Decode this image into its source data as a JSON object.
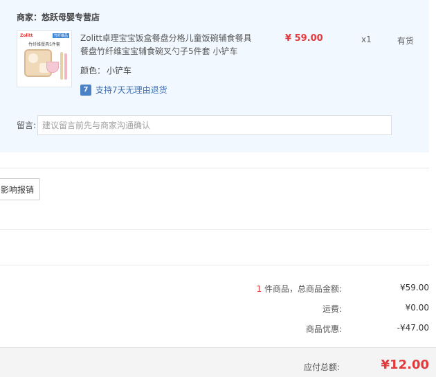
{
  "shop": {
    "seller_label": "商家：",
    "seller_name": "悠跃母婴专营店"
  },
  "product": {
    "thumb_brand": "Zolitt",
    "thumb_tag": "竹纤维品",
    "thumb_caption": "竹纤维餐具5件套",
    "title": "Zolitt卓理宝宝饭盒餐盘分格儿童饭碗辅食餐具餐盘竹纤维宝宝辅食碗叉勺子5件套 小铲车",
    "price": "¥ 59.00",
    "quantity": "x1",
    "stock": "有货",
    "spec_label": "颜色：",
    "spec_value": "小铲车",
    "return_icon_glyph": "7",
    "return_text": "支持7天无理由退货"
  },
  "note": {
    "label": "留言:",
    "placeholder": "建议留言前先与商家沟通确认",
    "value": ""
  },
  "invoice": {
    "button_label": "影响报销"
  },
  "summary": {
    "count": "1",
    "count_suffix": " 件商品，总商品金额:",
    "goods_amount": "¥59.00",
    "shipping_label": "运费:",
    "shipping_amount": "¥0.00",
    "discount_label": "商品优惠:",
    "discount_amount": "-¥47.00"
  },
  "total": {
    "label": "应付总额:",
    "amount": "¥12.00"
  },
  "colors": {
    "accent_red": "#e4393c",
    "panel_bg": "#f1f8ff",
    "link_blue": "#3d6fb0"
  }
}
